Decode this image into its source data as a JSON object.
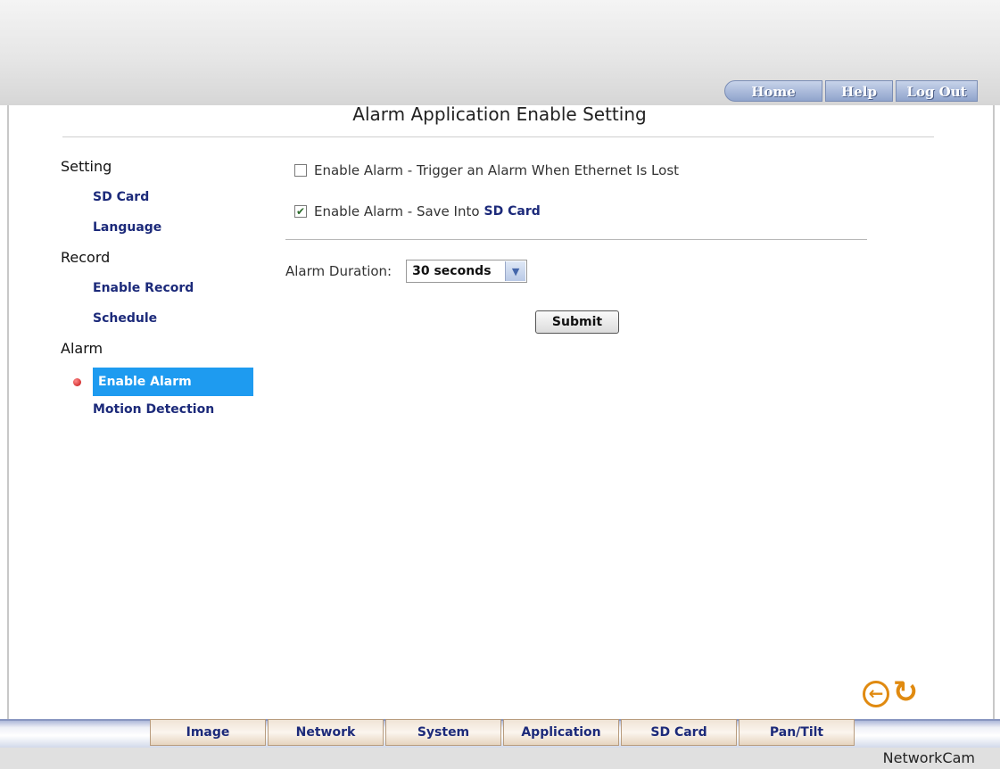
{
  "topnav": {
    "home": "Home",
    "help": "Help",
    "logout": "Log Out"
  },
  "page_title": "Alarm Application Enable Setting",
  "sidebar": {
    "sections": [
      {
        "heading": "Setting",
        "items": [
          "SD Card",
          "Language"
        ]
      },
      {
        "heading": "Record",
        "items": [
          "Enable Record",
          "Schedule"
        ]
      },
      {
        "heading": "Alarm",
        "items": [
          "Enable Alarm",
          "Motion Detection"
        ]
      }
    ],
    "active_item": "Enable Alarm"
  },
  "options": {
    "ethernet_lost": {
      "label": "Enable Alarm - Trigger an Alarm When Ethernet Is Lost",
      "checked": false
    },
    "save_sd": {
      "label": "Enable Alarm - Save Into",
      "link": "SD Card",
      "checked": true
    }
  },
  "duration": {
    "label": "Alarm Duration:",
    "value": "30 seconds"
  },
  "submit_label": "Submit",
  "tabs": [
    "Image",
    "Network",
    "System",
    "Application",
    "SD Card",
    "Pan/Tilt"
  ],
  "brand": "NetworkCam",
  "colors": {
    "accent": "#1e9bf0",
    "link": "#1c2a7a",
    "icon": "#e08a10"
  }
}
